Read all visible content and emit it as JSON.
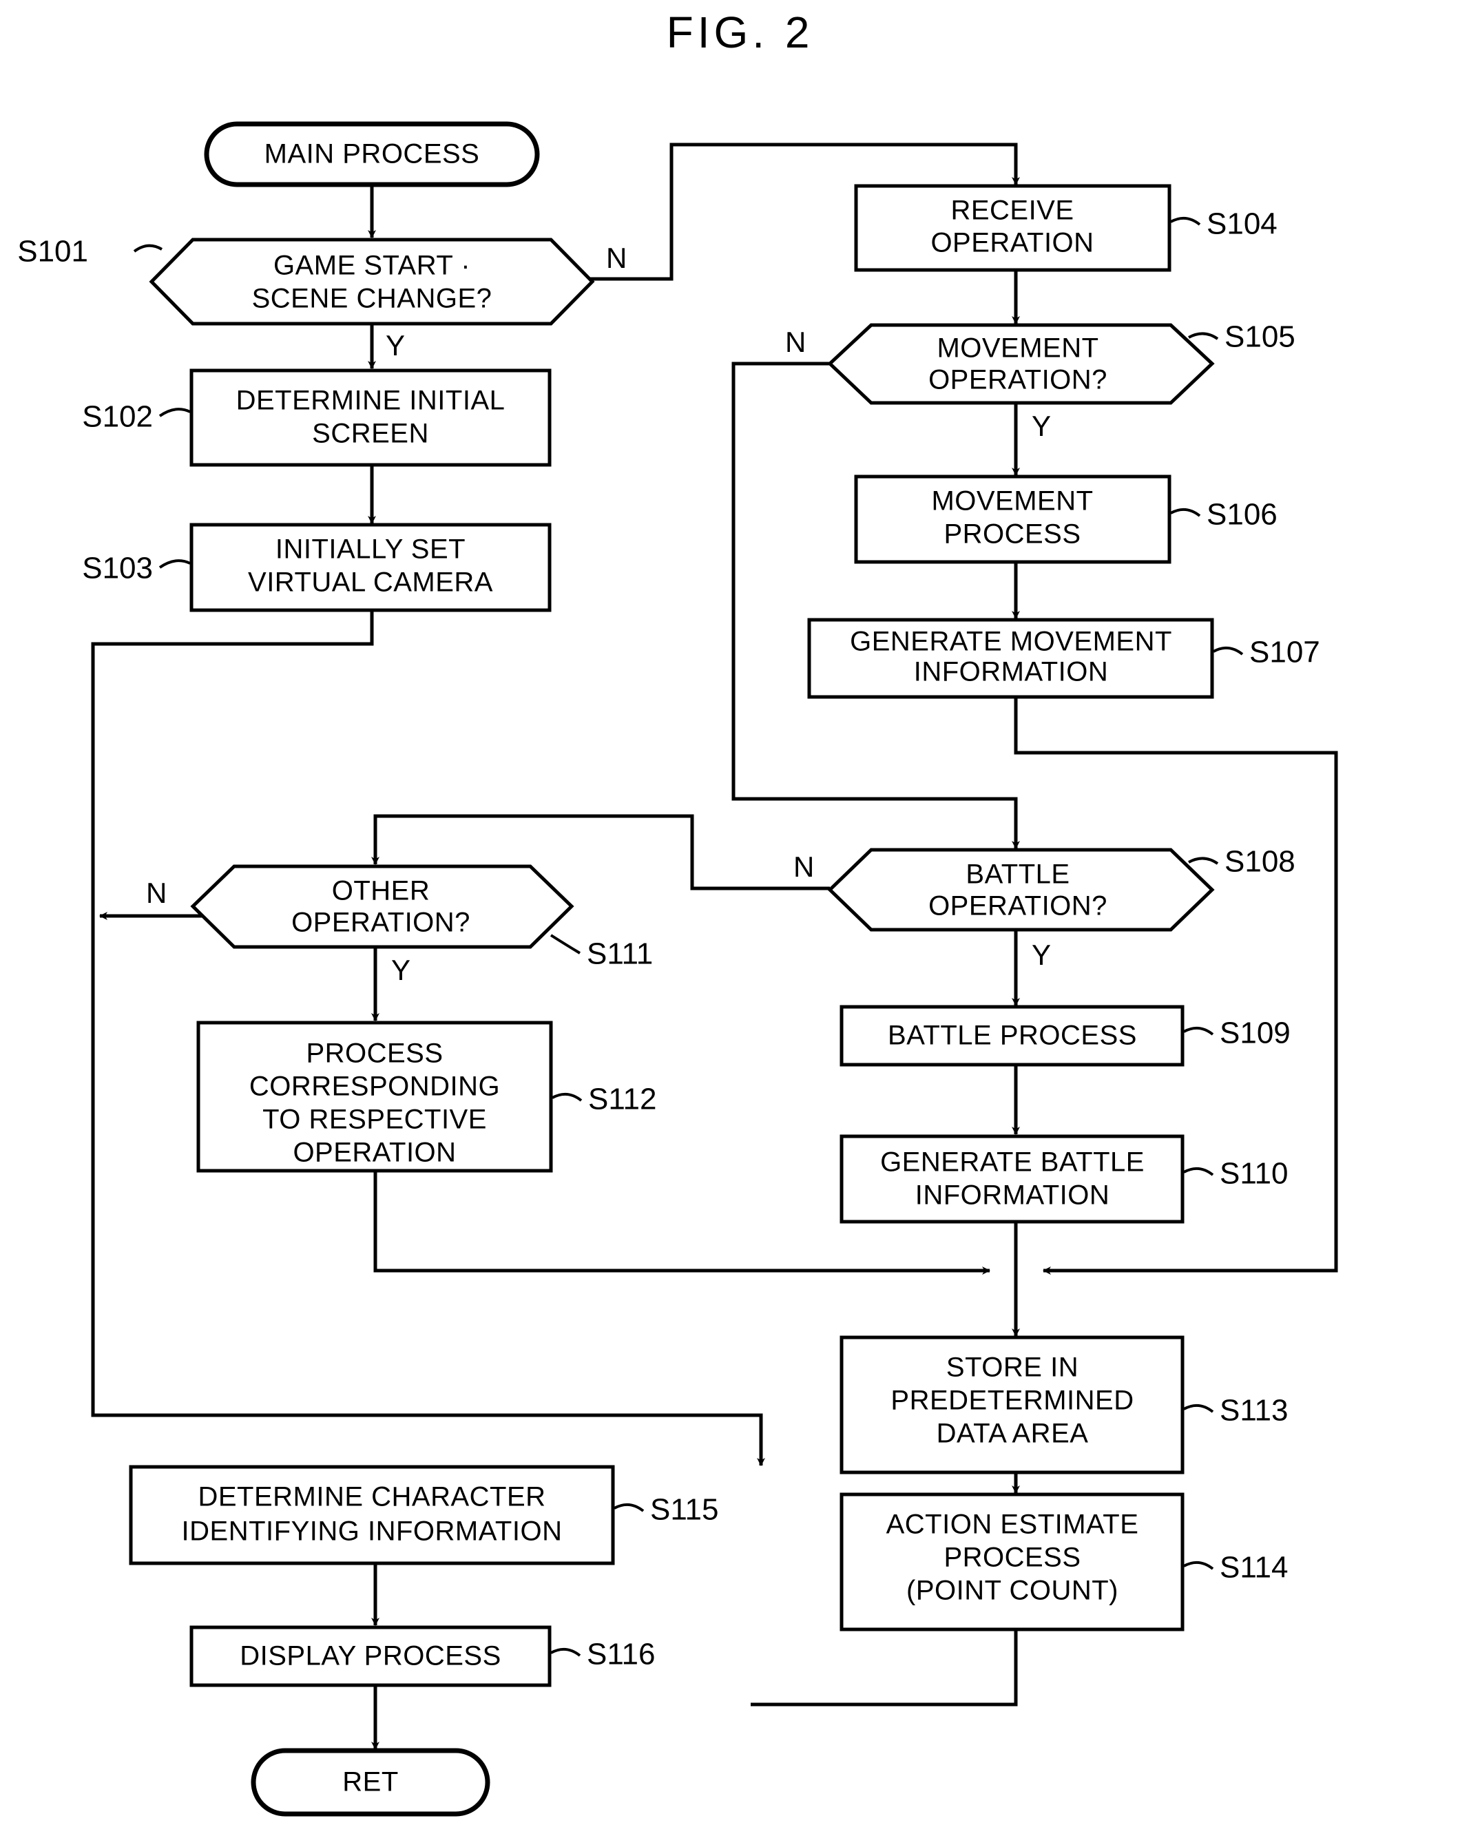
{
  "figure": {
    "title": "FIG. 2",
    "type": "flowchart"
  },
  "chart_data": {
    "type": "flowchart",
    "title": "FIG. 2",
    "nodes": [
      {
        "id": "start",
        "label": "MAIN PROCESS",
        "shape": "terminator",
        "step": ""
      },
      {
        "id": "s101",
        "label": "GAME START ·\nSCENE CHANGE?",
        "shape": "decision",
        "step": "S101"
      },
      {
        "id": "s102",
        "label": "DETERMINE INITIAL\nSCREEN",
        "shape": "process",
        "step": "S102"
      },
      {
        "id": "s103",
        "label": "INITIALLY SET\nVIRTUAL CAMERA",
        "shape": "process",
        "step": "S103"
      },
      {
        "id": "s104",
        "label": "RECEIVE\nOPERATION",
        "shape": "process",
        "step": "S104"
      },
      {
        "id": "s105",
        "label": "MOVEMENT\nOPERATION?",
        "shape": "decision",
        "step": "S105"
      },
      {
        "id": "s106",
        "label": "MOVEMENT\nPROCESS",
        "shape": "process",
        "step": "S106"
      },
      {
        "id": "s107",
        "label": "GENERATE MOVEMENT\nINFORMATION",
        "shape": "process",
        "step": "S107"
      },
      {
        "id": "s108",
        "label": "BATTLE\nOPERATION?",
        "shape": "decision",
        "step": "S108"
      },
      {
        "id": "s109",
        "label": "BATTLE PROCESS",
        "shape": "process",
        "step": "S109"
      },
      {
        "id": "s110",
        "label": "GENERATE BATTLE\nINFORMATION",
        "shape": "process",
        "step": "S110"
      },
      {
        "id": "s111",
        "label": "OTHER\nOPERATION?",
        "shape": "decision",
        "step": "S111"
      },
      {
        "id": "s112",
        "label": "PROCESS\nCORRESPONDING\nTO RESPECTIVE\nOPERATION",
        "shape": "process",
        "step": "S112"
      },
      {
        "id": "s113",
        "label": "STORE IN\nPREDETERMINED\nDATA AREA",
        "shape": "process",
        "step": "S113"
      },
      {
        "id": "s114",
        "label": "ACTION ESTIMATE\nPROCESS\n(POINT COUNT)",
        "shape": "process",
        "step": "S114"
      },
      {
        "id": "s115",
        "label": "DETERMINE CHARACTER\nIDENTIFYING INFORMATION",
        "shape": "process",
        "step": "S115"
      },
      {
        "id": "s116",
        "label": "DISPLAY PROCESS",
        "shape": "process",
        "step": "S116"
      },
      {
        "id": "ret",
        "label": "RET",
        "shape": "terminator",
        "step": ""
      }
    ],
    "edges": [
      {
        "from": "start",
        "to": "s101",
        "label": ""
      },
      {
        "from": "s101",
        "to": "s102",
        "label": "Y"
      },
      {
        "from": "s101",
        "to": "s104",
        "label": "N"
      },
      {
        "from": "s102",
        "to": "s103",
        "label": ""
      },
      {
        "from": "s103",
        "to": "s111",
        "label": ""
      },
      {
        "from": "s104",
        "to": "s105",
        "label": ""
      },
      {
        "from": "s105",
        "to": "s106",
        "label": "Y"
      },
      {
        "from": "s105",
        "to": "s108",
        "label": "N"
      },
      {
        "from": "s106",
        "to": "s107",
        "label": ""
      },
      {
        "from": "s107",
        "to": "s113",
        "label": ""
      },
      {
        "from": "s108",
        "to": "s109",
        "label": "Y"
      },
      {
        "from": "s108",
        "to": "s111",
        "label": "N"
      },
      {
        "from": "s109",
        "to": "s110",
        "label": ""
      },
      {
        "from": "s110",
        "to": "s113",
        "label": ""
      },
      {
        "from": "s111",
        "to": "s112",
        "label": "Y"
      },
      {
        "from": "s111",
        "to": "s115",
        "label": "N"
      },
      {
        "from": "s112",
        "to": "s113",
        "label": ""
      },
      {
        "from": "s113",
        "to": "s114",
        "label": ""
      },
      {
        "from": "s114",
        "to": "s115",
        "label": ""
      },
      {
        "from": "s115",
        "to": "s116",
        "label": ""
      },
      {
        "from": "s116",
        "to": "ret",
        "label": ""
      }
    ],
    "branch_labels": [
      "Y",
      "N"
    ]
  },
  "nodes": {
    "start": {
      "line1": "MAIN PROCESS"
    },
    "s101": {
      "line1": "GAME START ·",
      "line2": "SCENE CHANGE?",
      "step": "S101"
    },
    "s102": {
      "line1": "DETERMINE INITIAL",
      "line2": "SCREEN",
      "step": "S102"
    },
    "s103": {
      "line1": "INITIALLY SET",
      "line2": "VIRTUAL CAMERA",
      "step": "S103"
    },
    "s104": {
      "line1": "RECEIVE",
      "line2": "OPERATION",
      "step": "S104"
    },
    "s105": {
      "line1": "MOVEMENT",
      "line2": "OPERATION?",
      "step": "S105"
    },
    "s106": {
      "line1": "MOVEMENT",
      "line2": "PROCESS",
      "step": "S106"
    },
    "s107": {
      "line1": "GENERATE MOVEMENT",
      "line2": "INFORMATION",
      "step": "S107"
    },
    "s108": {
      "line1": "BATTLE",
      "line2": "OPERATION?",
      "step": "S108"
    },
    "s109": {
      "line1": "BATTLE PROCESS",
      "step": "S109"
    },
    "s110": {
      "line1": "GENERATE BATTLE",
      "line2": "INFORMATION",
      "step": "S110"
    },
    "s111": {
      "line1": "OTHER",
      "line2": "OPERATION?",
      "step": "S111"
    },
    "s112": {
      "line1": "PROCESS",
      "line2": "CORRESPONDING",
      "line3": "TO RESPECTIVE",
      "line4": "OPERATION",
      "step": "S112"
    },
    "s113": {
      "line1": "STORE IN",
      "line2": "PREDETERMINED",
      "line3": "DATA AREA",
      "step": "S113"
    },
    "s114": {
      "line1": "ACTION ESTIMATE",
      "line2": "PROCESS",
      "line3": "(POINT COUNT)",
      "step": "S114"
    },
    "s115": {
      "line1": "DETERMINE CHARACTER",
      "line2": "IDENTIFYING INFORMATION",
      "step": "S115"
    },
    "s116": {
      "line1": "DISPLAY PROCESS",
      "step": "S116"
    },
    "ret": {
      "line1": "RET"
    }
  },
  "branches": {
    "s101_n": "N",
    "s101_y": "Y",
    "s105_n": "N",
    "s105_y": "Y",
    "s108_n": "N",
    "s108_y": "Y",
    "s111_n": "N",
    "s111_y": "Y"
  },
  "colors": {
    "ink": "#000000",
    "paper": "#ffffff"
  }
}
